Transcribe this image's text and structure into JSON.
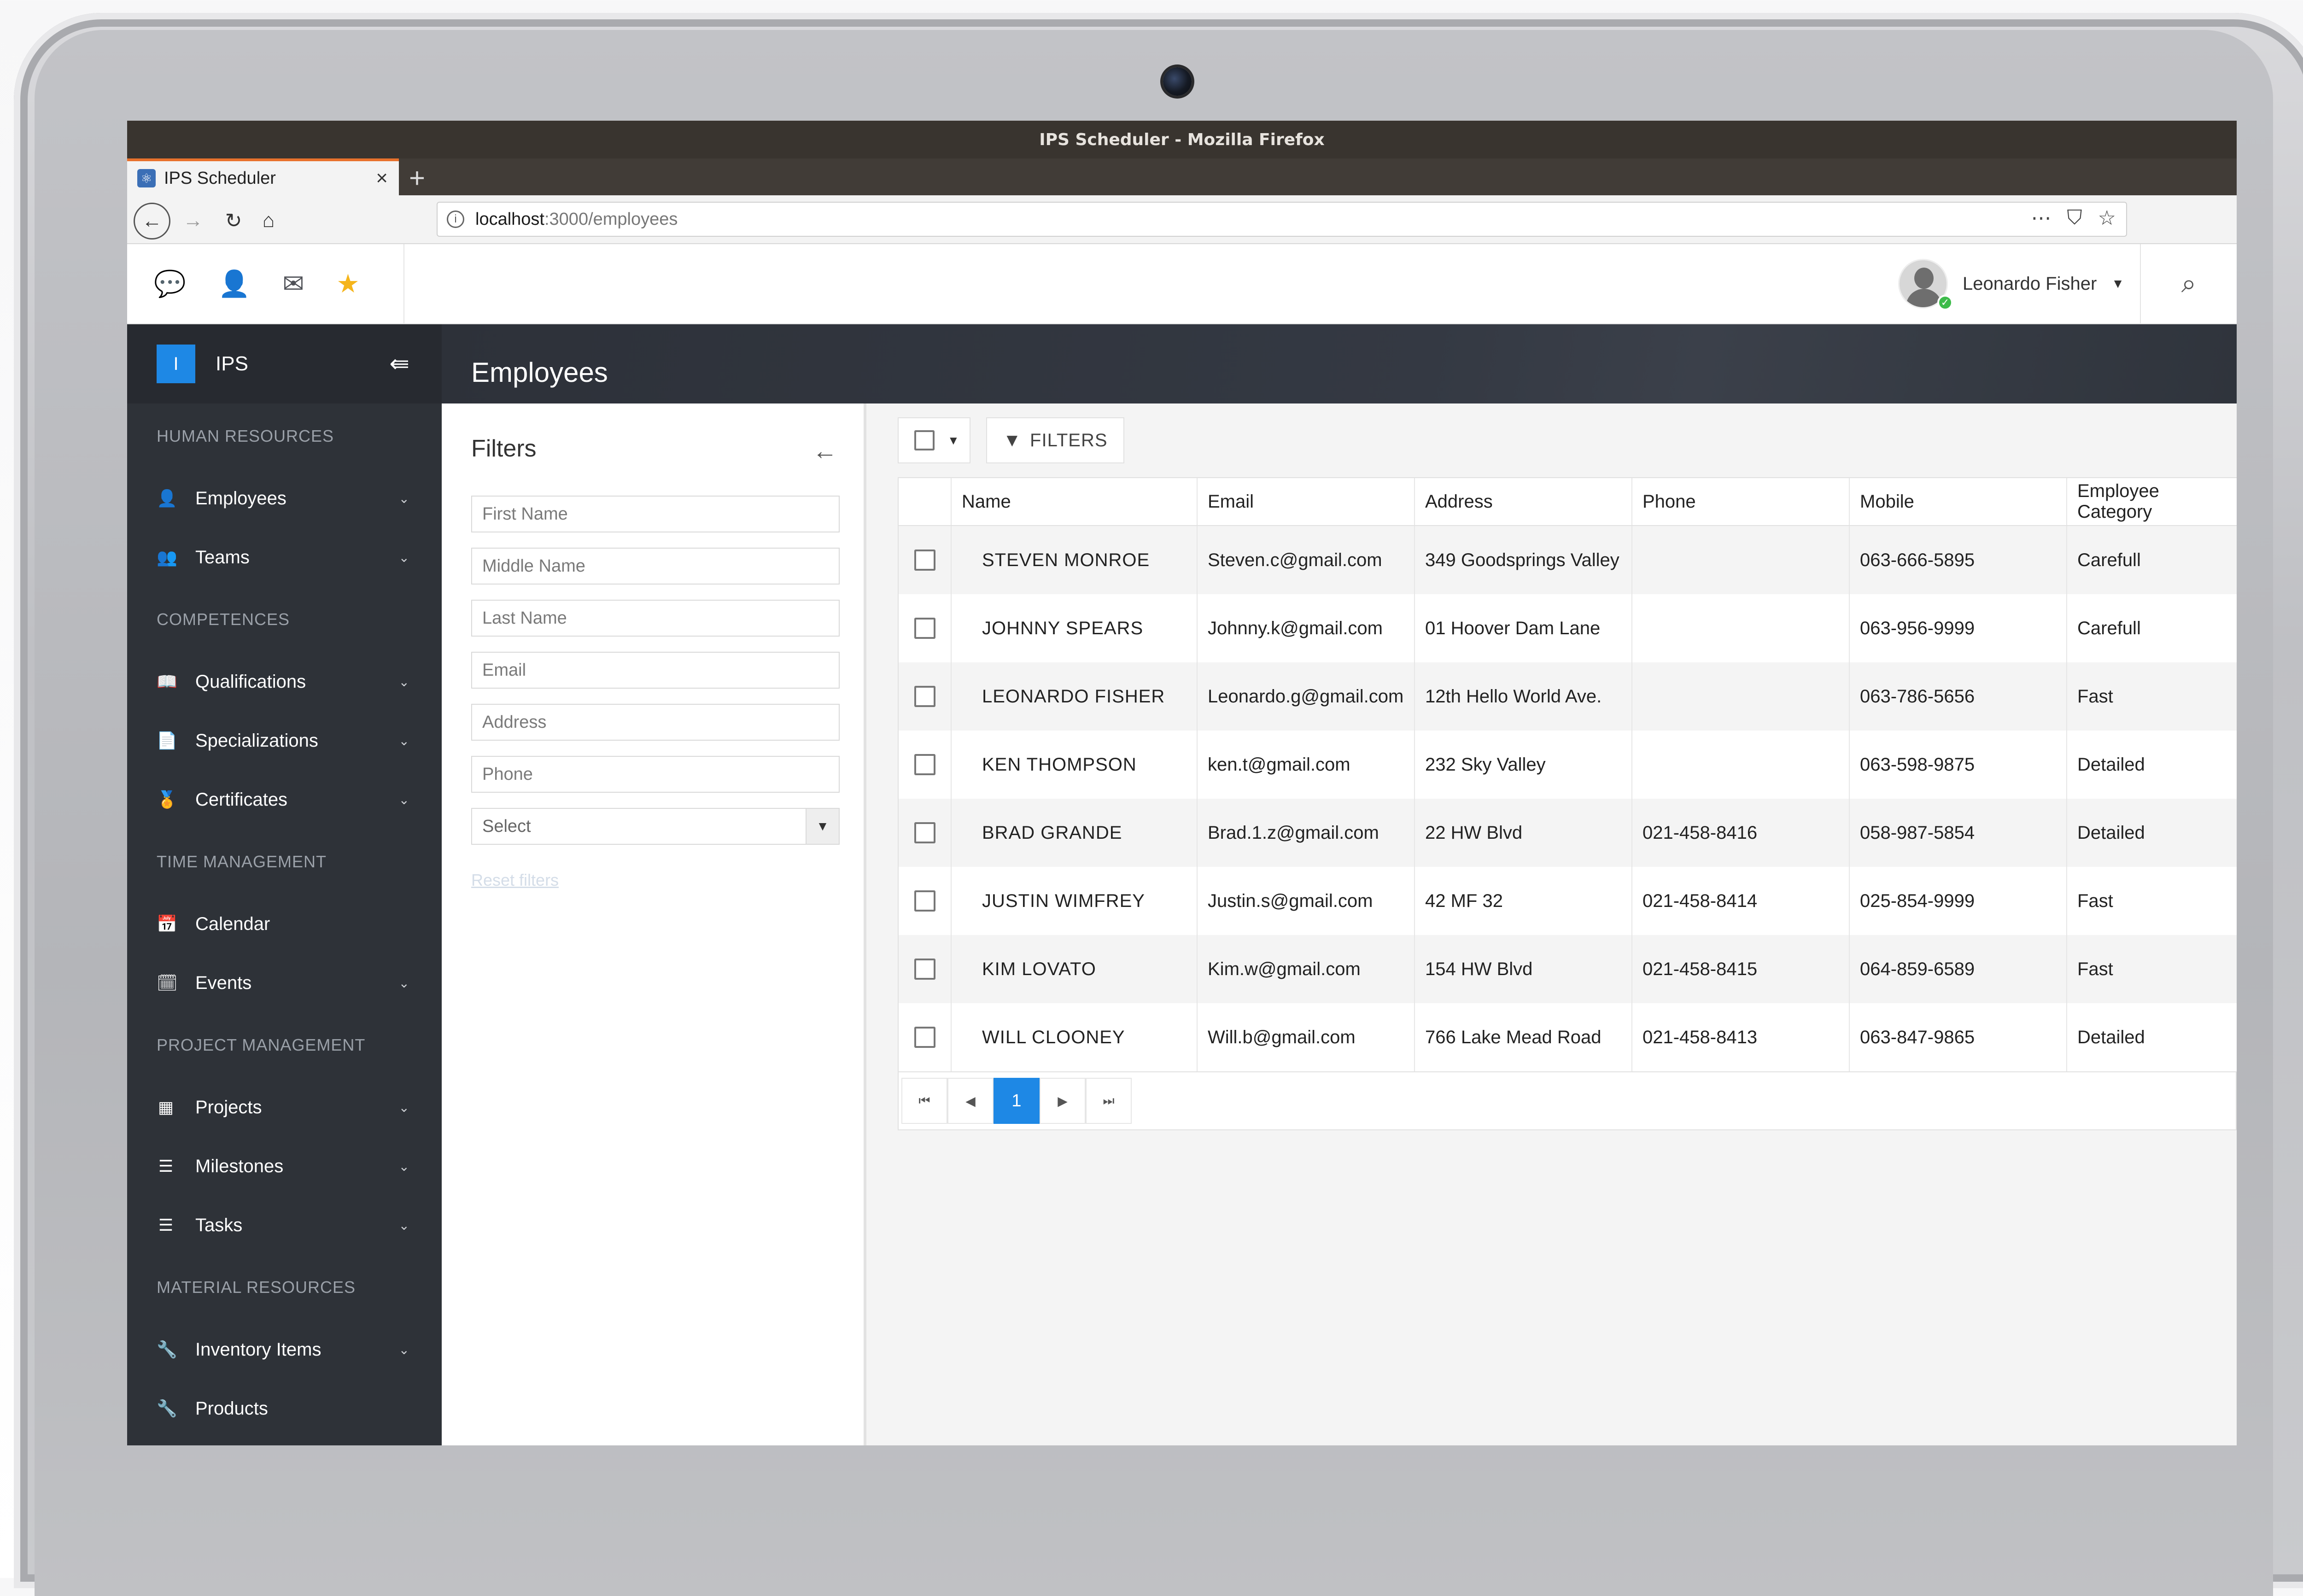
{
  "browser": {
    "window_title": "IPS Scheduler - Mozilla Firefox",
    "tab_title": "IPS Scheduler",
    "tab_close": "×",
    "new_tab": "+",
    "url_host": "localhost",
    "url_path": ":3000/employees"
  },
  "header": {
    "user_name": "Leonardo Fisher"
  },
  "sidebar": {
    "brand_badge": "I",
    "brand_name": "IPS",
    "sections": [
      {
        "title": "HUMAN RESOURCES",
        "items": [
          {
            "label": "Employees",
            "icon": "person-icon",
            "glyph": "👤",
            "has_caret": true
          },
          {
            "label": "Teams",
            "icon": "people-icon",
            "glyph": "👥",
            "has_caret": true
          }
        ]
      },
      {
        "title": "COMPETENCES",
        "items": [
          {
            "label": "Qualifications",
            "icon": "book-icon",
            "glyph": "📖",
            "has_caret": true
          },
          {
            "label": "Specializations",
            "icon": "document-icon",
            "glyph": "📄",
            "has_caret": true
          },
          {
            "label": "Certificates",
            "icon": "certificate-icon",
            "glyph": "🏅",
            "has_caret": true
          }
        ]
      },
      {
        "title": "TIME MANAGEMENT",
        "items": [
          {
            "label": "Calendar",
            "icon": "calendar-icon",
            "glyph": "📅",
            "has_caret": false
          },
          {
            "label": "Events",
            "icon": "event-icon",
            "glyph": "🗓",
            "has_caret": true
          }
        ]
      },
      {
        "title": "PROJECT MANAGEMENT",
        "items": [
          {
            "label": "Projects",
            "icon": "project-icon",
            "glyph": "▦",
            "has_caret": true
          },
          {
            "label": "Milestones",
            "icon": "list-check-icon",
            "glyph": "☰",
            "has_caret": true
          },
          {
            "label": "Tasks",
            "icon": "task-list-icon",
            "glyph": "☰",
            "has_caret": true
          }
        ]
      },
      {
        "title": "MATERIAL RESOURCES",
        "items": [
          {
            "label": "Inventory Items",
            "icon": "wrench-icon",
            "glyph": "🔧",
            "has_caret": true
          },
          {
            "label": "Products",
            "icon": "wrench-icon",
            "glyph": "🔧",
            "has_caret": false
          }
        ]
      }
    ]
  },
  "page": {
    "title": "Employees"
  },
  "filters": {
    "title": "Filters",
    "first_name_placeholder": "First Name",
    "middle_name_placeholder": "Middle Name",
    "last_name_placeholder": "Last Name",
    "email_placeholder": "Email",
    "address_placeholder": "Address",
    "phone_placeholder": "Phone",
    "select_value": "Select",
    "reset_label": "Reset filters"
  },
  "toolbar": {
    "filters_label": "FILTERS"
  },
  "table": {
    "columns": [
      "Name",
      "Email",
      "Address",
      "Phone",
      "Mobile",
      "Employee Category"
    ],
    "rows": [
      {
        "name": "STEVEN MONROE",
        "email": "Steven.c@gmail.com",
        "address": "349 Goodsprings Valley",
        "phone": "",
        "mobile": "063-666-5895",
        "category": "Carefull"
      },
      {
        "name": "JOHNNY SPEARS",
        "email": "Johnny.k@gmail.com",
        "address": "01 Hoover Dam Lane",
        "phone": "",
        "mobile": "063-956-9999",
        "category": "Carefull"
      },
      {
        "name": "LEONARDO FISHER",
        "email": "Leonardo.g@gmail.com",
        "address": "12th Hello World Ave.",
        "phone": "",
        "mobile": "063-786-5656",
        "category": "Fast"
      },
      {
        "name": "KEN THOMPSON",
        "email": "ken.t@gmail.com",
        "address": "232 Sky Valley",
        "phone": "",
        "mobile": "063-598-9875",
        "category": "Detailed"
      },
      {
        "name": "BRAD GRANDE",
        "email": "Brad.1.z@gmail.com",
        "address": "22 HW Blvd",
        "phone": "021-458-8416",
        "mobile": "058-987-5854",
        "category": "Detailed"
      },
      {
        "name": "JUSTIN WIMFREY",
        "email": "Justin.s@gmail.com",
        "address": "42 MF 32",
        "phone": "021-458-8414",
        "mobile": "025-854-9999",
        "category": "Fast"
      },
      {
        "name": "KIM LOVATO",
        "email": "Kim.w@gmail.com",
        "address": "154 HW Blvd",
        "phone": "021-458-8415",
        "mobile": "064-859-6589",
        "category": "Fast"
      },
      {
        "name": "WILL CLOONEY",
        "email": "Will.b@gmail.com",
        "address": "766 Lake Mead Road",
        "phone": "021-458-8413",
        "mobile": "063-847-9865",
        "category": "Detailed"
      }
    ]
  },
  "pagination": {
    "current_page": "1"
  },
  "colors": {
    "accent": "#1e88e5",
    "sidebar_bg": "#2e3238",
    "star": "#f5b51b",
    "online": "#3dbb4a"
  }
}
